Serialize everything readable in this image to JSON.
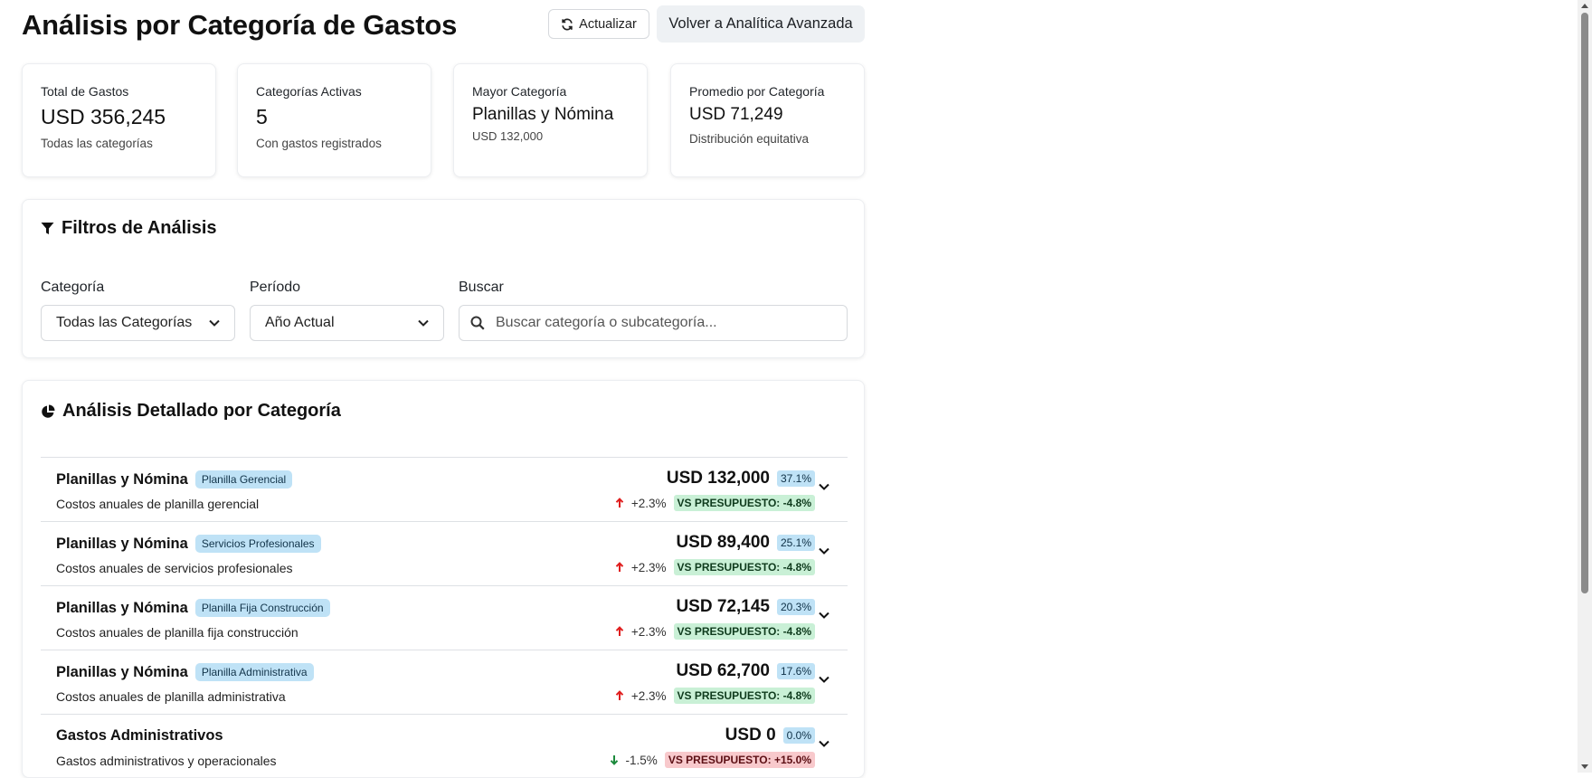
{
  "header": {
    "title": "Análisis por Categoría de Gastos",
    "refresh_label": "Actualizar",
    "back_label": "Volver a Analítica Avanzada"
  },
  "kpis": [
    {
      "label": "Total de Gastos",
      "value": "USD 356,245",
      "sub": "Todas las categorías"
    },
    {
      "label": "Categorías Activas",
      "value": "5",
      "sub": "Con gastos registrados"
    },
    {
      "label": "Mayor Categoría",
      "value": "Planillas y Nómina",
      "sub": "USD 132,000"
    },
    {
      "label": "Promedio por Categoría",
      "value": "USD 71,249",
      "sub": "Distribución equitativa"
    }
  ],
  "filters": {
    "title": "Filtros de Análisis",
    "category_label": "Categoría",
    "category_value": "Todas las Categorías",
    "period_label": "Período",
    "period_value": "Año Actual",
    "search_label": "Buscar",
    "search_placeholder": "Buscar categoría o subcategoría...",
    "search_value": ""
  },
  "detail": {
    "title": "Análisis Detallado por Categoría",
    "rows": [
      {
        "name": "Planillas y Nómina",
        "tag": "Planilla Gerencial",
        "desc": "Costos anuales de planilla gerencial",
        "amount": "USD 132,000",
        "pct": "37.1%",
        "trend": "+2.3%",
        "trend_dir": "up",
        "vs": "VS PRESUPUESTO: -4.8%",
        "vs_status": "good"
      },
      {
        "name": "Planillas y Nómina",
        "tag": "Servicios Profesionales",
        "desc": "Costos anuales de servicios profesionales",
        "amount": "USD 89,400",
        "pct": "25.1%",
        "trend": "+2.3%",
        "trend_dir": "up",
        "vs": "VS PRESUPUESTO: -4.8%",
        "vs_status": "good"
      },
      {
        "name": "Planillas y Nómina",
        "tag": "Planilla Fija Construcción",
        "desc": "Costos anuales de planilla fija construcción",
        "amount": "USD 72,145",
        "pct": "20.3%",
        "trend": "+2.3%",
        "trend_dir": "up",
        "vs": "VS PRESUPUESTO: -4.8%",
        "vs_status": "good"
      },
      {
        "name": "Planillas y Nómina",
        "tag": "Planilla Administrativa",
        "desc": "Costos anuales de planilla administrativa",
        "amount": "USD 62,700",
        "pct": "17.6%",
        "trend": "+2.3%",
        "trend_dir": "up",
        "vs": "VS PRESUPUESTO: -4.8%",
        "vs_status": "good"
      },
      {
        "name": "Gastos Administrativos",
        "tag": "",
        "desc": "Gastos administrativos y operacionales",
        "amount": "USD 0",
        "pct": "0.0%",
        "trend": "-1.5%",
        "trend_dir": "down",
        "vs": "VS PRESUPUESTO: +15.0%",
        "vs_status": "bad"
      }
    ]
  },
  "colors": {
    "trend_up": "#e01e1e",
    "trend_down": "#1c8a3c",
    "tag_bg": "#bfe2f6",
    "vs_good_bg": "#c9f0d6",
    "vs_bad_bg": "#f8c9cc"
  }
}
